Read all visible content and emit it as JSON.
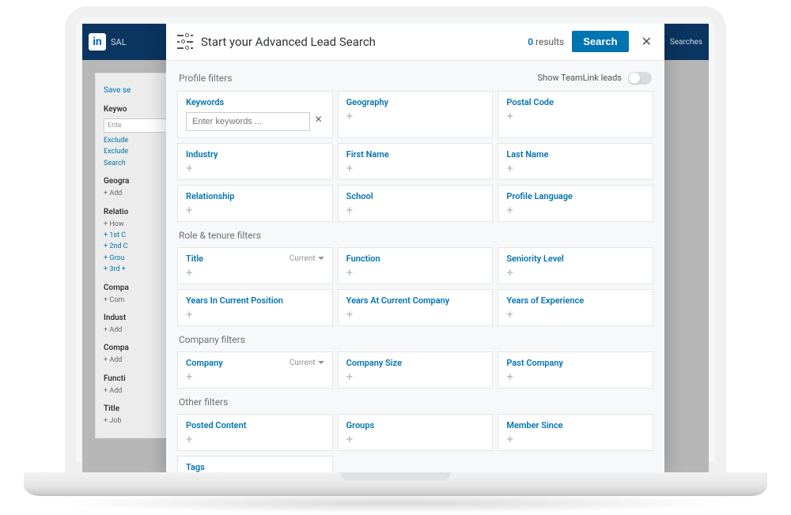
{
  "app": {
    "brand_text": "SAL",
    "searches_label": "Searches"
  },
  "sidebar": {
    "save": "Save se",
    "keywords": "Keywo",
    "enter": "Ente",
    "exclude1": "Exclude",
    "exclude2": "Exclude",
    "search": "Search",
    "geography": "Geogra",
    "add": "+ Add",
    "relationship": "Relatio",
    "how": "+ How",
    "first": "+ 1st C",
    "second": "+ 2nd C",
    "group": "+ Grou",
    "third": "+ 3rd +",
    "company": "Compa",
    "com": "+ Com",
    "industry": "Indust",
    "add2": "+ Add",
    "company2": "Compa",
    "add3": "+ Add",
    "function": "Functi",
    "add4": "+ Add",
    "title": "Title",
    "job": "+ Job"
  },
  "modal": {
    "title": "Start your Advanced Lead Search",
    "results_count": "0",
    "results_label": "results",
    "search_button": "Search",
    "teamlink_label": "Show TeamLink leads"
  },
  "sections": {
    "profile": "Profile filters",
    "role": "Role & tenure filters",
    "company": "Company filters",
    "other": "Other filters"
  },
  "filters": {
    "keywords": {
      "label": "Keywords",
      "placeholder": "Enter keywords ..."
    },
    "geography": "Geography",
    "postal_code": "Postal Code",
    "industry": "Industry",
    "first_name": "First Name",
    "last_name": "Last Name",
    "relationship": "Relationship",
    "school": "School",
    "profile_language": "Profile Language",
    "title": "Title",
    "function": "Function",
    "seniority": "Seniority Level",
    "years_position": "Years In Current Position",
    "years_company": "Years At Current Company",
    "years_experience": "Years of Experience",
    "company": "Company",
    "company_size": "Company Size",
    "past_company": "Past Company",
    "posted_content": "Posted Content",
    "groups": "Groups",
    "member_since": "Member Since",
    "tags": "Tags",
    "current_label": "Current"
  }
}
